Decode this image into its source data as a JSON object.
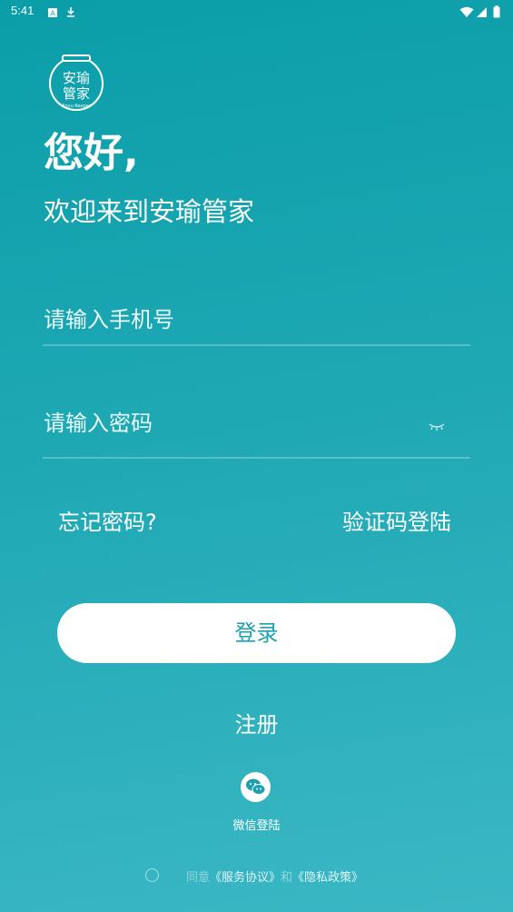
{
  "status_bar": {
    "time": "5:41",
    "left_icons": [
      "notification-a-icon",
      "download-icon"
    ],
    "right_icons": [
      "wifi-icon",
      "signal-icon",
      "battery-icon"
    ]
  },
  "logo": {
    "line1": "安瑜",
    "line2": "管家",
    "sub": "Anyu Keeper"
  },
  "greeting": {
    "hello": "您好,",
    "welcome": "欢迎来到安瑜管家"
  },
  "form": {
    "phone_placeholder": "请输入手机号",
    "password_placeholder": "请输入密码",
    "forgot_password": "忘记密码?",
    "sms_login": "验证码登陆",
    "login_button": "登录",
    "register": "注册"
  },
  "wechat": {
    "label": "微信登陆"
  },
  "agreement": {
    "agree": "同意",
    "service": "《服务协议》",
    "and": "和",
    "privacy": "《隐私政策》"
  },
  "colors": {
    "accent": "#1aa1ad",
    "bg_top": "#0a9ea9",
    "bg_bottom": "#3bb7c4"
  }
}
